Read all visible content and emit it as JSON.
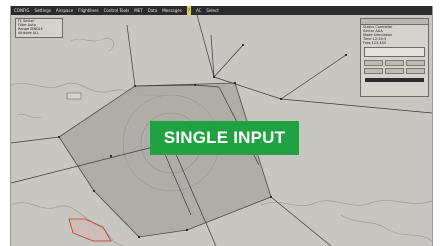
{
  "menubar": {
    "items": [
      "CONFIG",
      "Settings",
      "Airspace",
      "Flightlines",
      "Control Tools",
      "MET",
      "Data",
      "Messages",
      "?",
      "AC",
      "Select"
    ],
    "selected_index": 8
  },
  "left_panel": {
    "rows": [
      "FL  Sector",
      "Filter  Auto",
      "Range  SINGLE",
      "Altitude  ALL"
    ]
  },
  "right_panel": {
    "rows": [
      "Status  Controller",
      "Sector  AAA",
      "Mode  Simulation",
      "Time  12:34:5",
      "Freq  123.450"
    ]
  },
  "banner": {
    "text": "SINGLE INPUT"
  },
  "colors": {
    "map_background": "#c7c6c0",
    "sector_fill": "#a9a8a3",
    "route_line": "#3a3a3a",
    "banner": "#21a242",
    "restricted_area": "#c0392b"
  }
}
